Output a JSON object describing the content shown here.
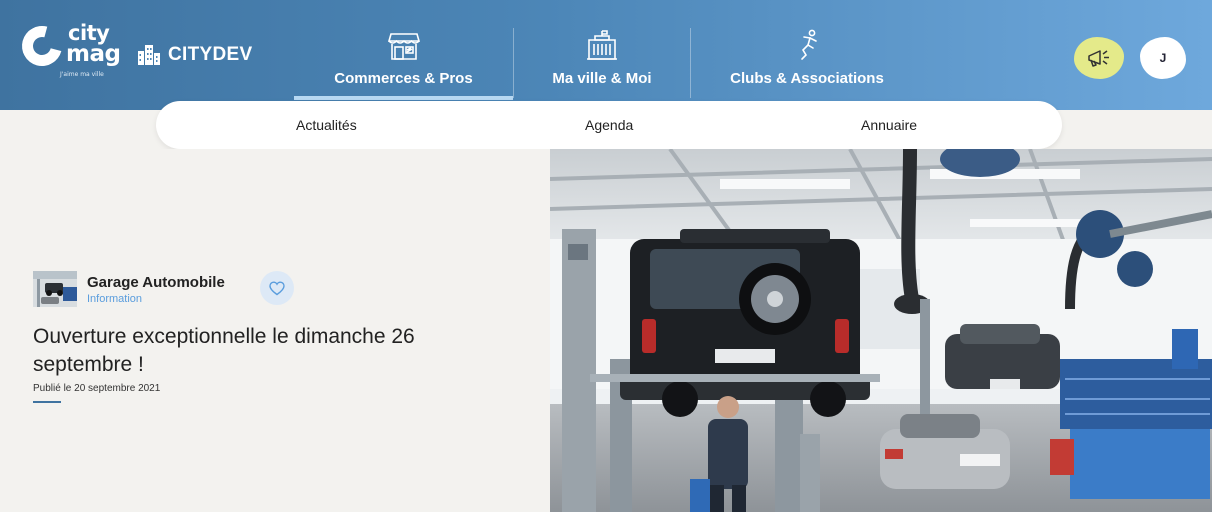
{
  "brand": {
    "logo_line1": "city",
    "logo_line2": "mag",
    "logo_tagline": "J'aime ma ville",
    "city_name": "CITYDEV"
  },
  "nav": {
    "items": [
      {
        "label": "Commerces & Pros",
        "icon": "shop-icon",
        "active": true
      },
      {
        "label": "Ma ville & Moi",
        "icon": "town-hall-icon",
        "active": false
      },
      {
        "label": "Clubs & Associations",
        "icon": "runner-icon",
        "active": false
      }
    ]
  },
  "header_actions": {
    "megaphone_icon": "megaphone-icon",
    "user_initial": "J"
  },
  "subnav": {
    "items": [
      "Actualités",
      "Agenda",
      "Annuaire"
    ]
  },
  "article": {
    "category_name": "Garage Automobile",
    "category_type": "Information",
    "title": "Ouverture exceptionnelle le dimanche 26 septembre !",
    "published": "Publié le 20 septembre 2021"
  },
  "colors": {
    "header_start": "#3f73a0",
    "header_end": "#6ea8dc",
    "accent_blue": "#5a9ddd",
    "megaphone_bg": "#e4ea8a",
    "page_bg": "#f3f2ef"
  }
}
